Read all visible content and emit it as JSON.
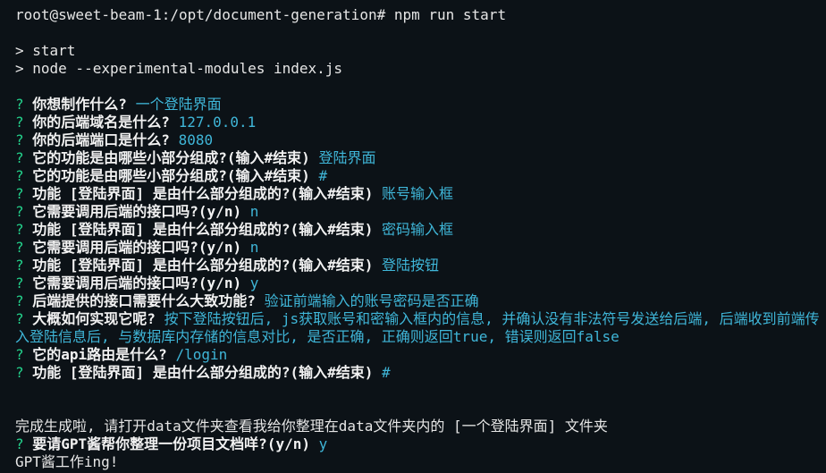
{
  "colors": {
    "background": "#0c1217",
    "prompt_mark": "#23d18b",
    "answer": "#3fb6d8",
    "text": "#e6e6e6"
  },
  "terminal": {
    "prompt_line": "root@sweet-beam-1:/opt/document-generation# npm run start",
    "npm_start": "> start",
    "npm_cmd": "> node --experimental-modules index.js",
    "qa": [
      {
        "q": "你想制作什么?",
        "a": "一个登陆界面"
      },
      {
        "q": "你的后端域名是什么?",
        "a": "127.0.0.1"
      },
      {
        "q": "你的后端端口是什么?",
        "a": "8080"
      },
      {
        "q": "它的功能是由哪些小部分组成?(输入#结束)",
        "a": "登陆界面"
      },
      {
        "q": "它的功能是由哪些小部分组成?(输入#结束)",
        "a": "#"
      },
      {
        "q": "功能 [登陆界面] 是由什么部分组成的?(输入#结束)",
        "a": "账号输入框"
      },
      {
        "q": "它需要调用后端的接口吗?(y/n)",
        "a": "n"
      },
      {
        "q": "功能 [登陆界面] 是由什么部分组成的?(输入#结束)",
        "a": "密码输入框"
      },
      {
        "q": "它需要调用后端的接口吗?(y/n)",
        "a": "n"
      },
      {
        "q": "功能 [登陆界面] 是由什么部分组成的?(输入#结束)",
        "a": "登陆按钮"
      },
      {
        "q": "它需要调用后端的接口吗?(y/n)",
        "a": "y"
      },
      {
        "q": "后端提供的接口需要什么大致功能?",
        "a": "验证前端输入的账号密码是否正确"
      },
      {
        "q": "大概如何实现它呢?",
        "a": "按下登陆按钮后, js获取账号和密输入框内的信息, 并确认没有非法符号发送给后端, 后端收到前端传入登陆信息后, 与数据库内存储的信息对比, 是否正确, 正确则返回true, 错误则返回false"
      },
      {
        "q": "它的api路由是什么?",
        "a": "/login"
      },
      {
        "q": "功能 [登陆界面] 是由什么部分组成的?(输入#结束)",
        "a": "#"
      }
    ],
    "done_msg": "完成生成啦, 请打开data文件夹查看我给你整理在data文件夹内的 [一个登陆界面] 文件夹",
    "gpt_q": "要请GPT酱帮你整理一份项目文档咩?(y/n)",
    "gpt_a": "y",
    "gpt_working": "GPT酱工作ing!",
    "mark": "?"
  }
}
